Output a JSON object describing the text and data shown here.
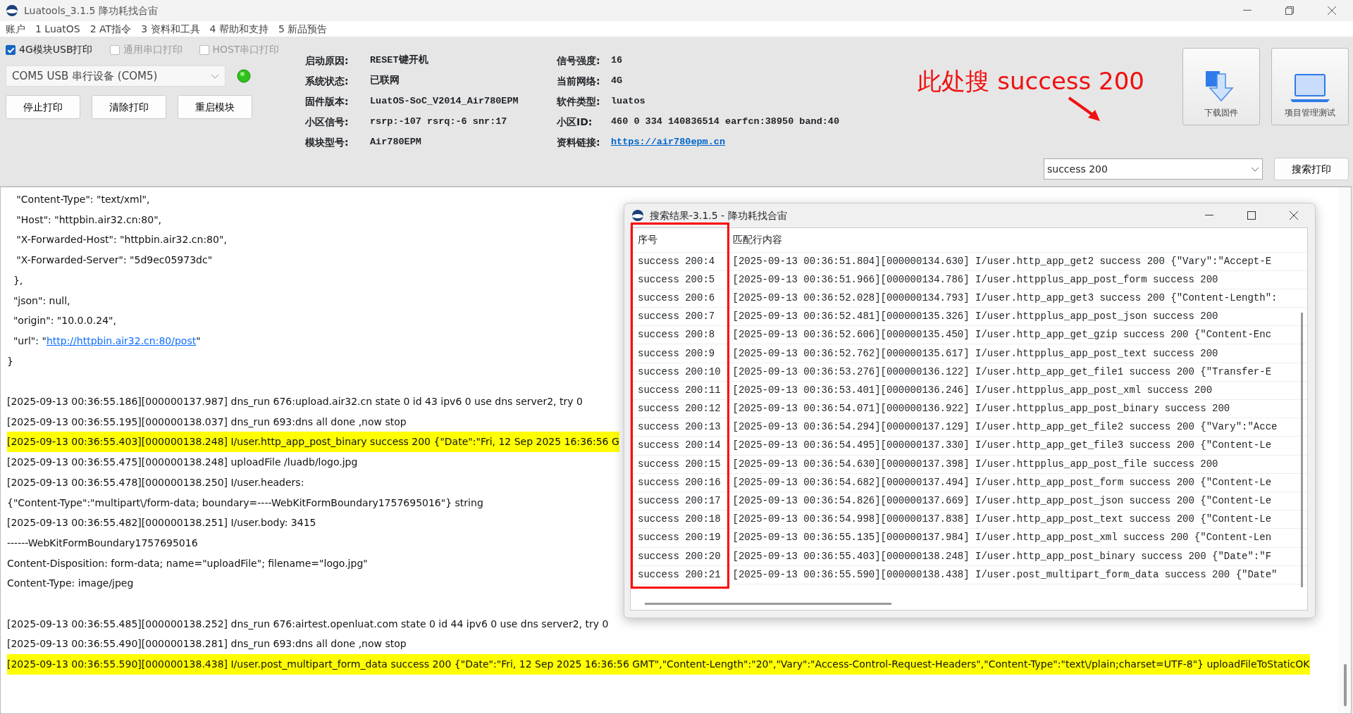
{
  "window": {
    "title": "Luatools_3.1.5 降功耗找合宙"
  },
  "menu": [
    "账户",
    "1 LuatOS",
    "2 AT指令",
    "3 资料和工具",
    "4 帮助和支持",
    "5 新品预告"
  ],
  "print_options": [
    {
      "label": "4G模块USB打印",
      "checked": true
    },
    {
      "label": "通用串口打印",
      "checked": false
    },
    {
      "label": "HOST串口打印",
      "checked": false
    }
  ],
  "port_select": {
    "value": "COM5 USB 串行设备 (COM5)"
  },
  "action_buttons": [
    "停止打印",
    "清除打印",
    "重启模块"
  ],
  "info_left": [
    {
      "label": "启动原因:",
      "value": "RESET键开机"
    },
    {
      "label": "系统状态:",
      "value": "已联网"
    },
    {
      "label": "固件版本:",
      "value": "LuatOS-SoC_V2014_Air780EPM"
    },
    {
      "label": "小区信号:",
      "value": "rsrp:-107 rsrq:-6 snr:17"
    },
    {
      "label": "模块型号:",
      "value": "Air780EPM"
    }
  ],
  "info_right": [
    {
      "label": "信号强度:",
      "value": "16",
      "kind": "text"
    },
    {
      "label": "当前网络:",
      "value": "4G",
      "kind": "text"
    },
    {
      "label": "软件类型:",
      "value": "luatos",
      "kind": "text"
    },
    {
      "label": "小区ID:",
      "value": "460 0 334 140836514 earfcn:38950 band:40",
      "kind": "text"
    },
    {
      "label": "资料链接:",
      "value": "https://air780epm.cn",
      "kind": "link"
    }
  ],
  "annotation": {
    "text": "此处搜 success 200"
  },
  "tool_buttons": [
    {
      "label": "下载固件",
      "kind": "download"
    },
    {
      "label": "项目管理测试",
      "kind": "project"
    }
  ],
  "search": {
    "value": "success 200",
    "button": "搜索打印"
  },
  "log_blocks": [
    [
      {
        "text": "   \"Content-Type\": \"text/xml\",",
        "highlighted": false
      },
      {
        "text": "   \"Host\": \"httpbin.air32.cn:80\",",
        "highlighted": false
      },
      {
        "text": "   \"X-Forwarded-Host\": \"httpbin.air32.cn:80\",",
        "highlighted": false
      },
      {
        "text": "   \"X-Forwarded-Server\": \"5d9ec05973dc\"",
        "highlighted": false
      },
      {
        "text": "  },",
        "highlighted": false
      },
      {
        "text": "  \"json\": null,",
        "highlighted": false
      },
      {
        "text": "  \"origin\": \"10.0.0.24\",",
        "highlighted": false
      },
      {
        "text": "  \"url\": \"",
        "link": "http://httpbin.air32.cn:80/post",
        "text_after": "\"",
        "highlighted": false
      },
      {
        "text": "}",
        "highlighted": false
      }
    ],
    [
      {
        "text": "[2025-09-13 00:36:55.186][000000137.987] dns_run 676:upload.air32.cn state 0 id 43 ipv6 0 use dns server2, try 0",
        "highlighted": false
      },
      {
        "text": "[2025-09-13 00:36:55.195][000000138.037] dns_run 693:dns all done ,now stop",
        "highlighted": false
      },
      {
        "text": "[2025-09-13 00:36:55.403][000000138.248] I/user.http_app_post_binary success 200 {\"Date\":\"Fri, 12 Sep 2025 16:36:56 G",
        "highlighted": true
      },
      {
        "text": "[2025-09-13 00:36:55.475][000000138.248] uploadFile /luadb/logo.jpg",
        "highlighted": false
      },
      {
        "text": "[2025-09-13 00:36:55.478][000000138.250] I/user.headers:",
        "highlighted": false
      },
      {
        "text": "{\"Content-Type\":\"multipart\\/form-data; boundary=----WebKitFormBoundary1757695016\"} string",
        "highlighted": false
      },
      {
        "text": "[2025-09-13 00:36:55.482][000000138.251] I/user.body: 3415",
        "highlighted": false
      },
      {
        "text": "------WebKitFormBoundary1757695016",
        "highlighted": false
      },
      {
        "text": "Content-Disposition: form-data; name=\"uploadFile\"; filename=\"logo.jpg\"",
        "highlighted": false
      },
      {
        "text": "Content-Type: image/jpeg",
        "highlighted": false
      }
    ],
    [
      {
        "text": "[2025-09-13 00:36:55.485][000000138.252] dns_run 676:airtest.openluat.com state 0 id 44 ipv6 0 use dns server2, try 0",
        "highlighted": false
      },
      {
        "text": "[2025-09-13 00:36:55.490][000000138.281] dns_run 693:dns all done ,now stop",
        "highlighted": false
      },
      {
        "text": "[2025-09-13 00:36:55.590][000000138.438] I/user.post_multipart_form_data success 200 {\"Date\":\"Fri, 12 Sep 2025 16:36:56 GMT\",\"Content-Length\":\"20\",\"Vary\":\"Access-Control-Request-Headers\",\"Content-Type\":\"text\\/plain;charset=UTF-8\"} uploadFileToStaticOK",
        "highlighted": true
      }
    ]
  ],
  "results_window": {
    "title": "搜索结果-3.1.5 - 降功耗找合宙",
    "columns": [
      "序号",
      "匹配行内容"
    ],
    "rows": [
      [
        "success 200:4",
        "[2025-09-13 00:36:51.804][000000134.630] I/user.http_app_get2 success 200 {\"Vary\":\"Accept-E"
      ],
      [
        "success 200:5",
        "[2025-09-13 00:36:51.966][000000134.786] I/user.httpplus_app_post_form success 200"
      ],
      [
        "success 200:6",
        "[2025-09-13 00:36:52.028][000000134.793] I/user.http_app_get3 success 200 {\"Content-Length\":"
      ],
      [
        "success 200:7",
        "[2025-09-13 00:36:52.481][000000135.326] I/user.httpplus_app_post_json success 200"
      ],
      [
        "success 200:8",
        "[2025-09-13 00:36:52.606][000000135.450] I/user.http_app_get_gzip success 200 {\"Content-Enc"
      ],
      [
        "success 200:9",
        "[2025-09-13 00:36:52.762][000000135.617] I/user.httpplus_app_post_text success 200"
      ],
      [
        "success 200:10",
        "[2025-09-13 00:36:53.276][000000136.122] I/user.http_app_get_file1 success 200 {\"Transfer-E"
      ],
      [
        "success 200:11",
        "[2025-09-13 00:36:53.401][000000136.246] I/user.httpplus_app_post_xml success 200"
      ],
      [
        "success 200:12",
        "[2025-09-13 00:36:54.071][000000136.922] I/user.httpplus_app_post_binary success 200"
      ],
      [
        "success 200:13",
        "[2025-09-13 00:36:54.294][000000137.129] I/user.http_app_get_file2 success 200 {\"Vary\":\"Acce"
      ],
      [
        "success 200:14",
        "[2025-09-13 00:36:54.495][000000137.330] I/user.http_app_get_file3 success 200 {\"Content-Le"
      ],
      [
        "success 200:15",
        "[2025-09-13 00:36:54.630][000000137.398] I/user.httpplus_app_post_file success 200"
      ],
      [
        "success 200:16",
        "[2025-09-13 00:36:54.682][000000137.494] I/user.http_app_post_form success 200 {\"Content-Le"
      ],
      [
        "success 200:17",
        "[2025-09-13 00:36:54.826][000000137.669] I/user.http_app_post_json success 200 {\"Content-Le"
      ],
      [
        "success 200:18",
        "[2025-09-13 00:36:54.998][000000137.838] I/user.http_app_post_text success 200 {\"Content-Le"
      ],
      [
        "success 200:19",
        "[2025-09-13 00:36:55.135][000000137.984] I/user.http_app_post_xml success 200 {\"Content-Len"
      ],
      [
        "success 200:20",
        "[2025-09-13 00:36:55.403][000000138.248] I/user.http_app_post_binary success 200 {\"Date\":\"F"
      ],
      [
        "success 200:21",
        "[2025-09-13 00:36:55.590][000000138.438] I/user.post_multipart_form_data success 200 {\"Date\""
      ]
    ]
  }
}
